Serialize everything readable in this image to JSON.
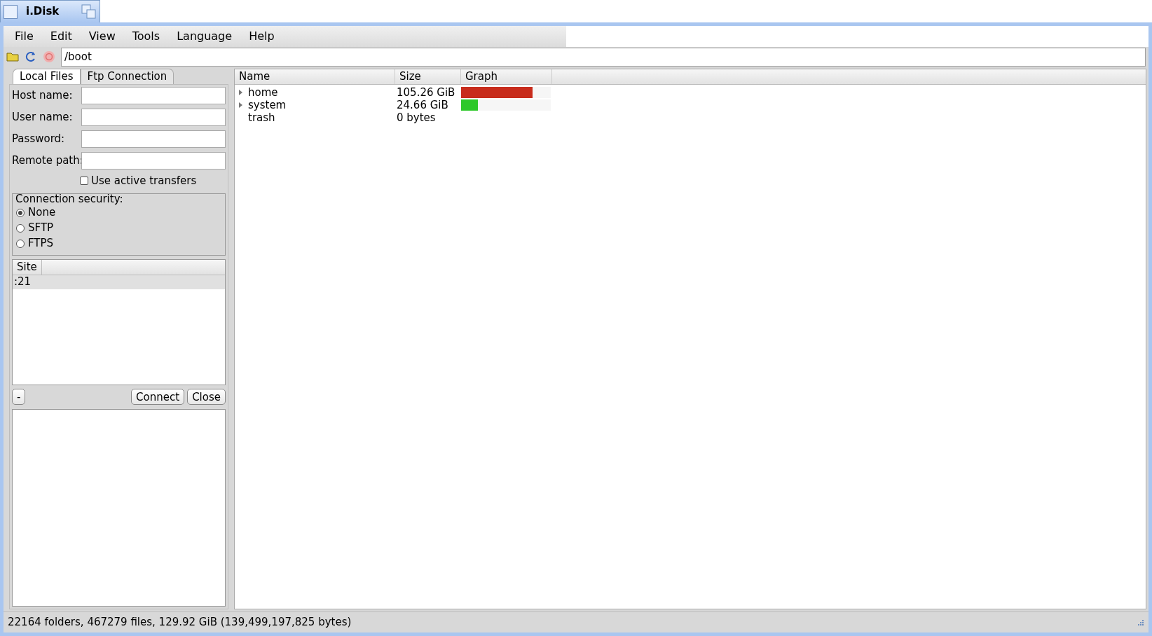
{
  "window": {
    "title": "i.Disk"
  },
  "menu": [
    "File",
    "Edit",
    "View",
    "Tools",
    "Language",
    "Help"
  ],
  "path": {
    "value": "/boot"
  },
  "tabs": [
    {
      "label": "Local Files",
      "selected": true
    },
    {
      "label": "Ftp Connection",
      "selected": false
    }
  ],
  "form": [
    {
      "label": "Host name:"
    },
    {
      "label": "User name:"
    },
    {
      "label": "Password:"
    },
    {
      "label": "Remote path:"
    }
  ],
  "active_transfers": {
    "label": "Use active transfers",
    "checked": false
  },
  "security": {
    "title": "Connection security:",
    "options": [
      {
        "label": "None",
        "selected": true
      },
      {
        "label": "SFTP",
        "selected": false
      },
      {
        "label": "FTPS",
        "selected": false
      }
    ]
  },
  "sites": {
    "columns": [
      "Site"
    ],
    "rows": [
      {
        "site": ":21",
        "selected": true
      }
    ]
  },
  "buttons": {
    "remove": "-",
    "connect": "Connect",
    "close": "Close"
  },
  "table": {
    "columns": [
      "Name",
      "Size",
      "Graph"
    ],
    "rows": [
      {
        "name": "home",
        "size": "105.26 GiB",
        "expandable": true,
        "level": 0.8,
        "color": "#c82c1c"
      },
      {
        "name": "system",
        "size": "24.66 GiB",
        "expandable": true,
        "level": 0.19,
        "color": "#2ec82a"
      },
      {
        "name": "trash",
        "size": "0 bytes",
        "expandable": false
      }
    ]
  },
  "status_bar": "22164 folders, 467279 files, 129.92 GiB (139,499,197,825 bytes)"
}
